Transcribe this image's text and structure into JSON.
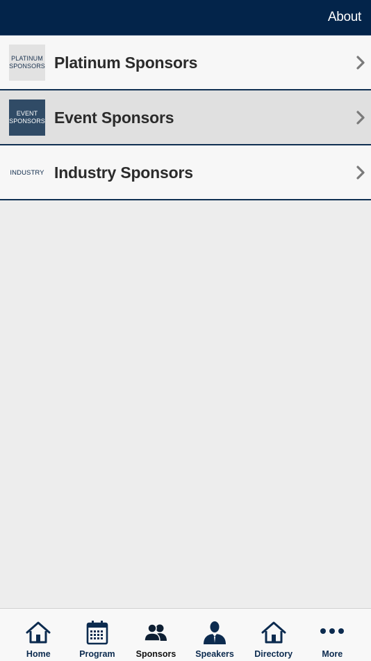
{
  "header": {
    "about_label": "About"
  },
  "list": {
    "items": [
      {
        "thumb_line1": "PLATINUM",
        "thumb_line2": "SPONSORS",
        "label": "Platinum Sponsors"
      },
      {
        "thumb_line1": "EVENT",
        "thumb_line2": "SPONSORS",
        "label": "Event Sponsors"
      },
      {
        "thumb_line1": "INDUSTRY",
        "thumb_line2": "",
        "label": "Industry Sponsors"
      }
    ]
  },
  "tabbar": {
    "tabs": [
      {
        "label": "Home",
        "icon": "home-icon"
      },
      {
        "label": "Program",
        "icon": "calendar-icon"
      },
      {
        "label": "Sponsors",
        "icon": "people-icon"
      },
      {
        "label": "Speakers",
        "icon": "speaker-icon"
      },
      {
        "label": "Directory",
        "icon": "directory-icon"
      },
      {
        "label": "More",
        "icon": "more-icon"
      }
    ]
  },
  "colors": {
    "header_bg": "#03244a",
    "tab_icon": "#0c2b4f",
    "selected_row": "#e0e0e0"
  }
}
